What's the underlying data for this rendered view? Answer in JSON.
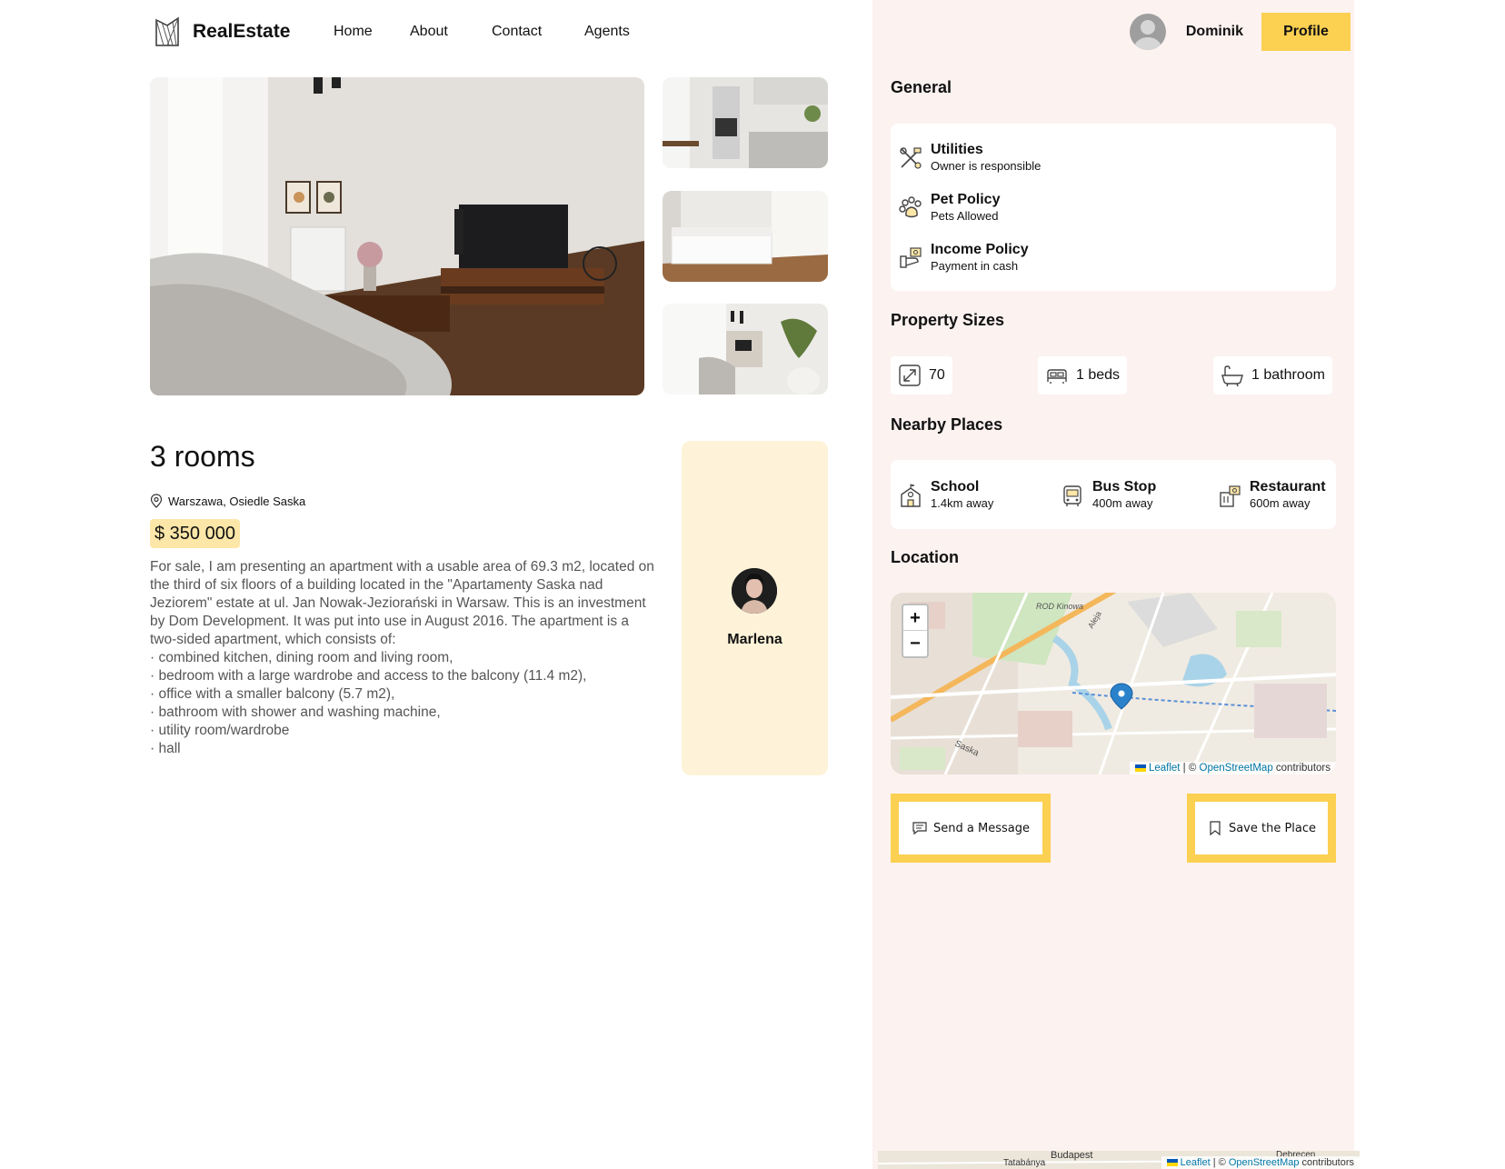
{
  "header": {
    "brand": "RealEstate",
    "nav": [
      "Home",
      "About",
      "Contact",
      "Agents"
    ],
    "user_name": "Dominik",
    "profile_label": "Profile"
  },
  "listing": {
    "title": "3 rooms",
    "address": "Warszawa,  Osiedle Saska",
    "price": "$ 350 000",
    "description": [
      "For sale, I am presenting an apartment with a usable area of 69.3 m2, located on",
      "the third of six floors of a building located in the \"Apartamenty Saska nad",
      "Jeziorem\" estate at ul. Jan Nowak-Jeziorański in Warsaw. This is an investment",
      "by Dom Development. It was put into use in August 2016. The apartment is a",
      "two-sided apartment, which consists of:",
      "· combined kitchen, dining room and living room,",
      "· bedroom with a large wardrobe and access to the balcony (11.4 m2),",
      "· office with a smaller balcony (5.7 m2),",
      "· bathroom with shower and washing machine,",
      "· utility room/wardrobe",
      "· hall"
    ]
  },
  "agent": {
    "name": "Marlena"
  },
  "general": {
    "title": "General",
    "items": [
      {
        "icon": "tools-icon",
        "title": "Utilities",
        "value": "Owner is responsible"
      },
      {
        "icon": "paw-icon",
        "title": "Pet Policy",
        "value": "Pets Allowed"
      },
      {
        "icon": "income-icon",
        "title": "Income Policy",
        "value": "Payment in cash"
      }
    ]
  },
  "sizes": {
    "title": "Property Sizes",
    "area": "70",
    "beds": "1 beds",
    "bathrooms": "1 bathroom"
  },
  "nearby": {
    "title": "Nearby Places",
    "items": [
      {
        "icon": "school-icon",
        "title": "School",
        "value": "1.4km away"
      },
      {
        "icon": "bus-icon",
        "title": "Bus Stop",
        "value": "400m away"
      },
      {
        "icon": "restaurant-icon",
        "title": "Restaurant",
        "value": "600m away"
      }
    ]
  },
  "location": {
    "title": "Location",
    "zoom_in": "+",
    "zoom_out": "−",
    "attribution": {
      "leaflet": "Leaflet",
      "sep": " | © ",
      "osm": "OpenStreetMap",
      "suffix": " contributors"
    },
    "map_labels": [
      "Saska",
      "ROD Kinowa",
      "Aleja"
    ]
  },
  "actions": {
    "send_message": "Send a Message",
    "save_place": "Save the Place"
  },
  "bottom_map": {
    "labels": [
      "Budapest",
      "Tatabánya",
      "Debrecen"
    ]
  },
  "colors": {
    "accent": "#fcd051",
    "panel_bg": "#fcf2f0",
    "agent_card": "#fef3d9",
    "price_bg": "#fce6a8"
  }
}
